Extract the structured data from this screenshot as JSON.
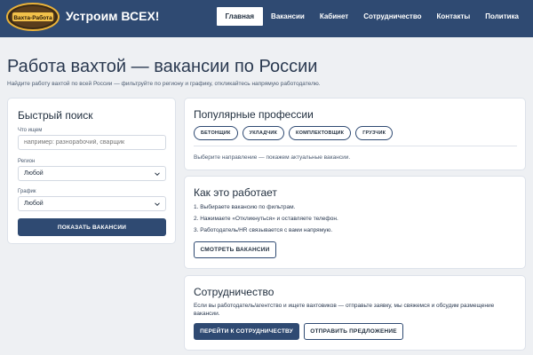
{
  "header": {
    "brand": "Устроим ВСЕХ!",
    "logo_text": "Вахта-Работа",
    "nav": [
      {
        "label": "Главная",
        "active": true
      },
      {
        "label": "Вакансии",
        "active": false
      },
      {
        "label": "Кабинет",
        "active": false
      },
      {
        "label": "Сотрудничество",
        "active": false
      },
      {
        "label": "Контакты",
        "active": false
      },
      {
        "label": "Политика",
        "active": false
      }
    ]
  },
  "hero": {
    "title": "Работа вахтой — вакансии по России",
    "subtitle": "Найдите работу вахтой по всей России — фильтруйте по региону и графику, откликайтесь напрямую работодателю."
  },
  "search": {
    "title": "Быстрый поиск",
    "query_label": "Что ищем",
    "query_placeholder": "например: разнорабочий, сварщик",
    "query_value": "",
    "region_label": "Регион",
    "region_value": "Любой",
    "schedule_label": "График",
    "schedule_value": "Любой",
    "submit_label": "ПОКАЗАТЬ ВАКАНСИИ"
  },
  "professions": {
    "title": "Популярные профессии",
    "chips": [
      "БЕТОНЩИК",
      "УКЛАДЧИК",
      "КОМПЛЕКТОВЩИК",
      "ГРУЗЧИК"
    ],
    "hint": "Выберите направление — покажем актуальные вакансии."
  },
  "how": {
    "title": "Как это работает",
    "steps": [
      "1. Выбираете вакансию по фильтрам.",
      "2. Нажимаете «Откликнуться» и оставляете телефон.",
      "3. Работодатель/HR связывается с вами напрямую."
    ],
    "button_label": "СМОТРЕТЬ ВАКАНСИИ"
  },
  "coop": {
    "title": "Сотрудничество",
    "text": "Если вы работодатель/агентство и ищете вахтовиков — отправьте заявку, мы свяжемся и обсудим размещение вакансии.",
    "primary_label": "ПЕРЕЙТИ К СОТРУДНИЧЕСТВУ",
    "secondary_label": "ОТПРАВИТЬ ПРЕДЛОЖЕНИЕ"
  },
  "colors": {
    "header_bg": "#2f4a72",
    "page_bg": "#eef0f3",
    "accent": "#2f4a72"
  }
}
